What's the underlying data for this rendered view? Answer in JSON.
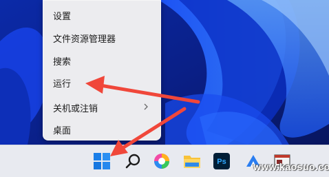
{
  "context_menu": {
    "items": [
      {
        "label": "设置"
      },
      {
        "label": "文件资源管理器"
      },
      {
        "label": "搜索"
      },
      {
        "label": "运行"
      },
      {
        "label": "关机或注销",
        "has_submenu": true
      },
      {
        "label": "桌面"
      }
    ]
  },
  "taskbar": {
    "icons": [
      "start-icon",
      "search-icon",
      "color-app-icon",
      "file-explorer-icon",
      "photoshop-icon",
      "app-icon",
      "app-window-icon"
    ],
    "photoshop_label": "Ps"
  },
  "watermark": "www.kaosuo.com",
  "colors": {
    "annotation_arrow": "#f0473a",
    "menu_bg": "#ececef",
    "taskbar_bg": "#e8eaf0",
    "wallpaper_base": "#0a1a6e"
  }
}
